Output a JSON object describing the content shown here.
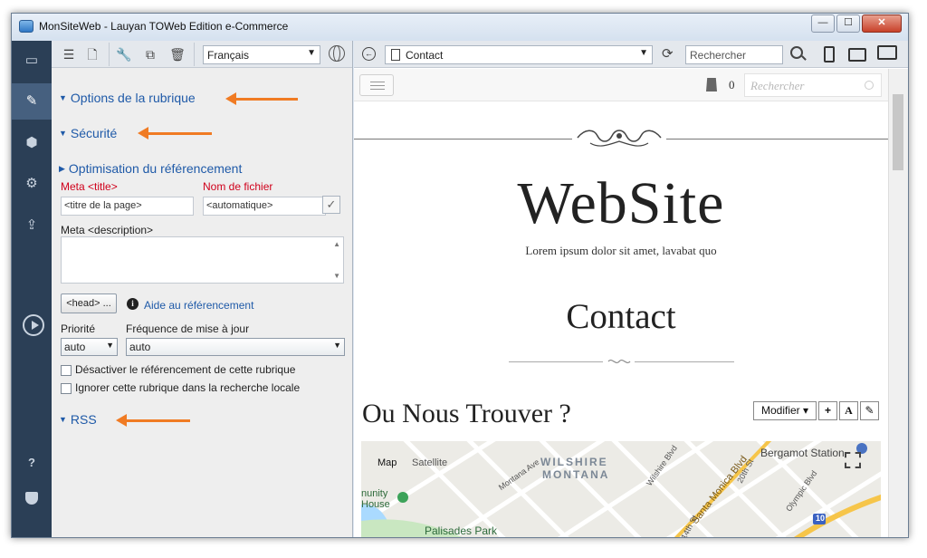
{
  "window": {
    "title": "MonSiteWeb - Lauyan TOWeb Edition e-Commerce",
    "controls": {
      "minimize": "—",
      "maximize": "☐",
      "close": "✕"
    }
  },
  "sidebar_nav": {
    "items": [
      {
        "icon": "folder-icon"
      },
      {
        "icon": "pencil-icon"
      },
      {
        "icon": "paint-bucket-icon"
      },
      {
        "icon": "gears-icon"
      },
      {
        "icon": "upload-icon"
      },
      {
        "icon": "play-icon"
      }
    ],
    "help_label": "?",
    "shield_icon": "shield-icon"
  },
  "left_toolbar": {
    "language": "Français"
  },
  "sections": {
    "options": "Options de la rubrique",
    "security": "Sécurité",
    "seo": "Optimisation du référencement",
    "rss": "RSS"
  },
  "seo_form": {
    "meta_title_label": "Meta <title>",
    "meta_title_value": "<titre de la page>",
    "filename_label": "Nom de fichier",
    "filename_value": "<automatique>",
    "meta_description_label": "Meta <description>",
    "meta_description_value": "",
    "head_button": "<head> ...",
    "help_link": "Aide au référencement",
    "priority_label": "Priorité",
    "priority_value": "auto",
    "frequency_label": "Fréquence de mise à jour",
    "frequency_value": "auto",
    "checkbox_disable": "Désactiver le référencement de cette rubrique",
    "checkbox_ignore": "Ignorer cette rubrique dans la recherche locale"
  },
  "right_toolbar": {
    "page": "Contact",
    "search_placeholder": "Rechercher"
  },
  "website": {
    "cart_count": "0",
    "search_placeholder": "Rechercher",
    "brand": "WebSite",
    "tagline": "Lorem ipsum dolor sit amet, lavabat quo",
    "page_heading": "Contact",
    "section_title": "Ou Nous Trouver ?",
    "edit_button": "Modifier ▾",
    "add_button": "+",
    "text_button": "A",
    "pen_button": "✎"
  },
  "map": {
    "tab_map": "Map",
    "tab_satellite": "Satellite",
    "labels": {
      "wilshire": "WILSHIRE",
      "montana": "MONTANA",
      "bergamot": "Bergamot Station",
      "palisades": "Palisades Park",
      "community": "nunity",
      "house": "House",
      "santa_monica": "Santa Monica Blvd",
      "montana_ave": "Montana Ave",
      "wilshire_blvd": "Wilshire Blvd",
      "olympic_blvd": "Olympic Blvd",
      "st_20": "20th St",
      "st_14": "14th St",
      "route": "10"
    }
  },
  "colors": {
    "sidebar": "#2b3f56",
    "section_link": "#1f5aa8",
    "required_label": "#d0001b",
    "annotation_arrow": "#f07b23"
  }
}
